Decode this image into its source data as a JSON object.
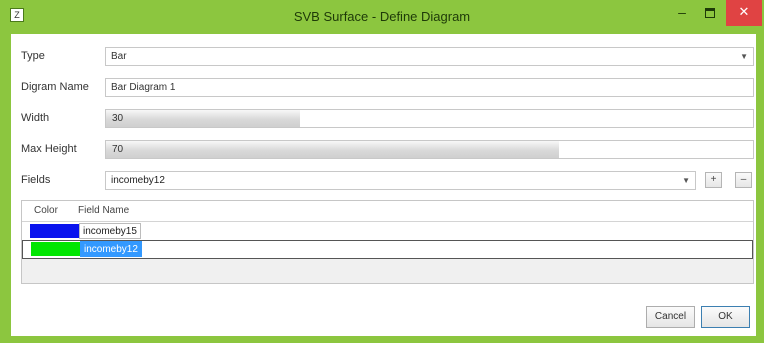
{
  "window": {
    "title": "SVB Surface - Define Diagram",
    "accent_color": "#8cc63f",
    "close_color": "#e04343",
    "controls": {
      "minimize": "–",
      "close": "✕"
    },
    "app_icon": "Z"
  },
  "form": {
    "type": {
      "label": "Type",
      "value": "Bar"
    },
    "diagram_name": {
      "label": "Digram Name",
      "value": "Bar Diagram 1"
    },
    "width": {
      "label": "Width",
      "value": "30",
      "fill_fraction": 0.3
    },
    "max_height": {
      "label": "Max Height",
      "value": "70",
      "fill_fraction": 0.7
    },
    "fields": {
      "label": "Fields",
      "selected": "incomeby12",
      "add_label": "+",
      "remove_label": "–"
    }
  },
  "grid": {
    "headers": {
      "color": "Color",
      "field_name": "Field Name"
    },
    "rows": [
      {
        "color": "#0a14ee",
        "field_name": "incomeby15",
        "selected": false
      },
      {
        "color": "#00e600",
        "field_name": "incomeby12",
        "selected": true
      }
    ]
  },
  "buttons": {
    "cancel": "Cancel",
    "ok": "OK"
  }
}
